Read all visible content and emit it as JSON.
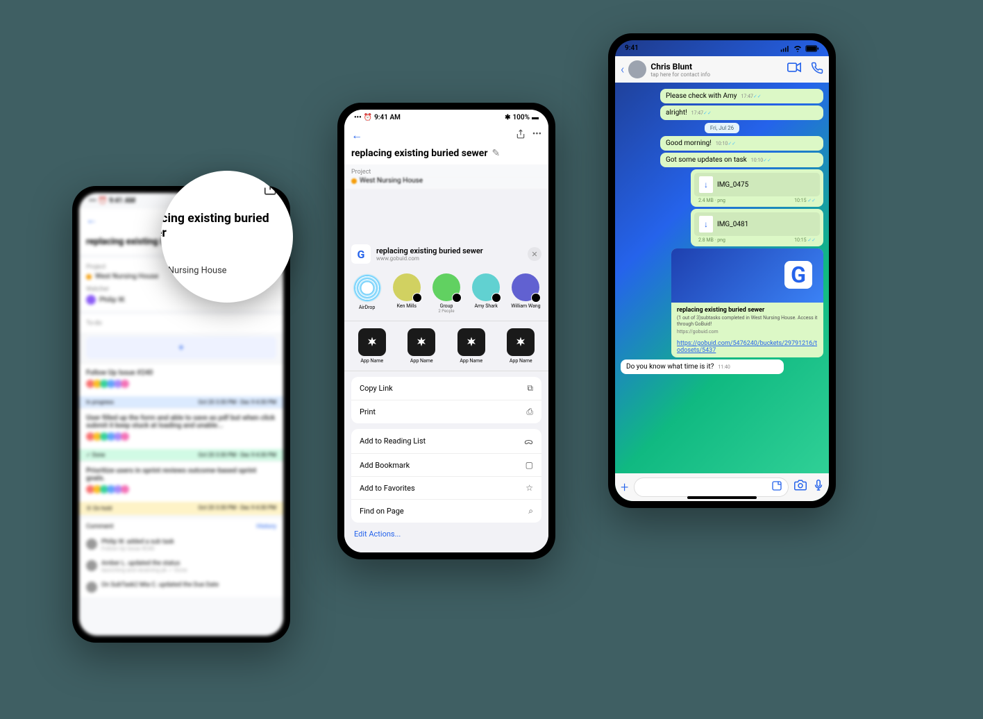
{
  "status": {
    "time": "9:41 AM",
    "battery": "100%"
  },
  "phone1": {
    "title": "replacing existing buried sewer",
    "project_label": "Project",
    "project_value": "West Nursing House",
    "watcher_label": "Watcher",
    "watcher_value": "Philip W.",
    "todo_label": "To-do",
    "tasks": [
      {
        "title": "Follow Up Issue #240",
        "status_label": "In progress",
        "dates": "Oct 20 3:30 PM - Dec 9 4:30 PM",
        "tone": "blue"
      },
      {
        "title": "User filled up the form and able to save as pdf but when click submit it keep stuck at loading and unable...",
        "status_label": "✓ Done",
        "dates": "Oct 20 3:30 PM - Dec 9 4:30 PM",
        "tone": "green"
      },
      {
        "title": "Prioritize users in sprint reviews outcome-based sprint goals.",
        "status_label": "⦿ On hold",
        "dates": "Oct 20 3:30 PM - Dec 9 4:30 PM",
        "tone": "yellow"
      }
    ],
    "comment_label": "Comment",
    "history_label": "History",
    "comments": [
      {
        "text": "Philip W. added a sub task",
        "sub": "Follow Up Issue #240"
      },
      {
        "text": "Amber L. updated the status",
        "sub": "launching and receiving pk ✓ Done"
      },
      {
        "text": "On SubTask2 Mia C. updated the Due Date",
        "sub": ""
      }
    ]
  },
  "phone2": {
    "title": "replacing existing buried sewer",
    "project_label": "Project",
    "project_value": "West Nursing House",
    "sheet": {
      "title": "replacing existing buried sewer",
      "url": "www.gobuid.com",
      "share_targets": [
        {
          "name": "AirDrop",
          "sub": ""
        },
        {
          "name": "Ken Mills",
          "sub": ""
        },
        {
          "name": "Group",
          "sub": "2 People"
        },
        {
          "name": "Amy Shark",
          "sub": ""
        },
        {
          "name": "William Wang",
          "sub": ""
        }
      ],
      "app_label": "App Name",
      "actions1": [
        {
          "label": "Copy Link",
          "icon": "⧉"
        },
        {
          "label": "Print",
          "icon": "⎙"
        }
      ],
      "actions2": [
        {
          "label": "Add to Reading List",
          "icon": "ᯅ"
        },
        {
          "label": "Add Bookmark",
          "icon": "▢"
        },
        {
          "label": "Add to Favorites",
          "icon": "☆"
        },
        {
          "label": "Find on Page",
          "icon": "⌕"
        }
      ],
      "edit_actions": "Edit Actions..."
    }
  },
  "phone3": {
    "status_time": "9:41",
    "contact_name": "Chris Blunt",
    "contact_sub": "tap here for contact info",
    "messages": {
      "m1": {
        "text": "Please check with Amy",
        "time": "17:47"
      },
      "m2": {
        "text": "alright!",
        "time": "17:47"
      },
      "date": "Fri, Jul 26",
      "m3": {
        "text": "Good morning!",
        "time": "10:10"
      },
      "m4": {
        "text": "Got some updates on task",
        "time": "10:10"
      },
      "f1": {
        "name": "IMG_0475",
        "size": "2.4 MB",
        "type": "png",
        "time": "10:15"
      },
      "f2": {
        "name": "IMG_0481",
        "size": "2.8 MB",
        "type": "png",
        "time": "10:15"
      },
      "link": {
        "title": "replacing existing buried sewer",
        "desc": "(1 out of 3)subtasks completed in West Nursing House. Access it through GoBuid!",
        "domain": "https://gobuid.com",
        "url": "https://gobuid.com/5476240/buckets/29791216/todosets/5437"
      },
      "m5": {
        "text": "Do you know what time is it?",
        "time": "11:40"
      }
    }
  }
}
